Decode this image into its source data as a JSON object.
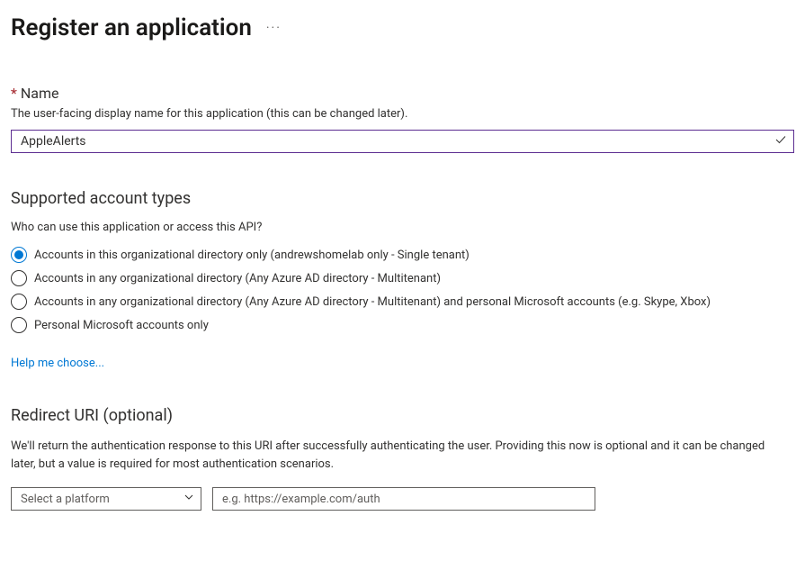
{
  "header": {
    "title": "Register an application"
  },
  "name_field": {
    "label": "Name",
    "description": "The user-facing display name for this application (this can be changed later).",
    "value": "AppleAlerts"
  },
  "account_types": {
    "heading": "Supported account types",
    "subtext": "Who can use this application or access this API?",
    "options": [
      "Accounts in this organizational directory only (andrewshomelab only - Single tenant)",
      "Accounts in any organizational directory (Any Azure AD directory - Multitenant)",
      "Accounts in any organizational directory (Any Azure AD directory - Multitenant) and personal Microsoft accounts (e.g. Skype, Xbox)",
      "Personal Microsoft accounts only"
    ],
    "selected_index": 0,
    "help_link": "Help me choose..."
  },
  "redirect_uri": {
    "heading": "Redirect URI (optional)",
    "description": "We'll return the authentication response to this URI after successfully authenticating the user. Providing this now is optional and it can be changed later, but a value is required for most authentication scenarios.",
    "platform_placeholder": "Select a platform",
    "uri_placeholder": "e.g. https://example.com/auth"
  }
}
